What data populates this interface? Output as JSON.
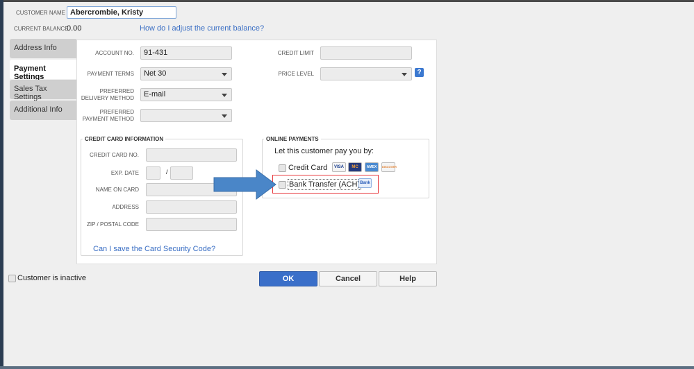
{
  "header": {
    "customer_name_label": "CUSTOMER NAME",
    "customer_name": "Abercrombie, Kristy",
    "balance_label": "CURRENT BALANCE",
    "balance": "0.00",
    "balance_link": "How do I adjust the current balance?"
  },
  "tabs": [
    {
      "label": "Address Info"
    },
    {
      "label": "Payment Settings"
    },
    {
      "label": "Sales Tax Settings"
    },
    {
      "label": "Additional Info"
    }
  ],
  "payment": {
    "account_label": "ACCOUNT NO.",
    "account": "91-431",
    "terms_label": "PAYMENT TERMS",
    "terms": "Net 30",
    "delivery_label1": "PREFERRED",
    "delivery_label2": "DELIVERY METHOD",
    "delivery": "E-mail",
    "method_label1": "PREFERRED",
    "method_label2": "PAYMENT METHOD",
    "method": "",
    "credit_limit_label": "CREDIT LIMIT",
    "credit_limit": "",
    "price_level_label": "PRICE LEVEL",
    "price_level": "",
    "help": "?"
  },
  "credit_card": {
    "title": "CREDIT CARD INFORMATION",
    "number_label": "CREDIT CARD NO.",
    "exp_label": "EXP. DATE",
    "slash": "/",
    "name_label": "NAME ON CARD",
    "address_label": "ADDRESS",
    "zip_label": "ZIP / POSTAL CODE",
    "link": "Can I save the Card Security Code?"
  },
  "online": {
    "title": "ONLINE PAYMENTS",
    "prompt": "Let this customer pay you by:",
    "credit_card": "Credit Card",
    "bank": "Bank Transfer (ACH)",
    "bank_icon": "Bank",
    "cards": [
      "VISA",
      "MC",
      "AMEX",
      "DISCOVER"
    ]
  },
  "footer": {
    "inactive": "Customer is inactive",
    "ok": "OK",
    "cancel": "Cancel",
    "help": "Help"
  },
  "colors": {
    "highlight": "#e8383d",
    "arrow": "#4a86c8",
    "ok": "#3a6fc9"
  }
}
